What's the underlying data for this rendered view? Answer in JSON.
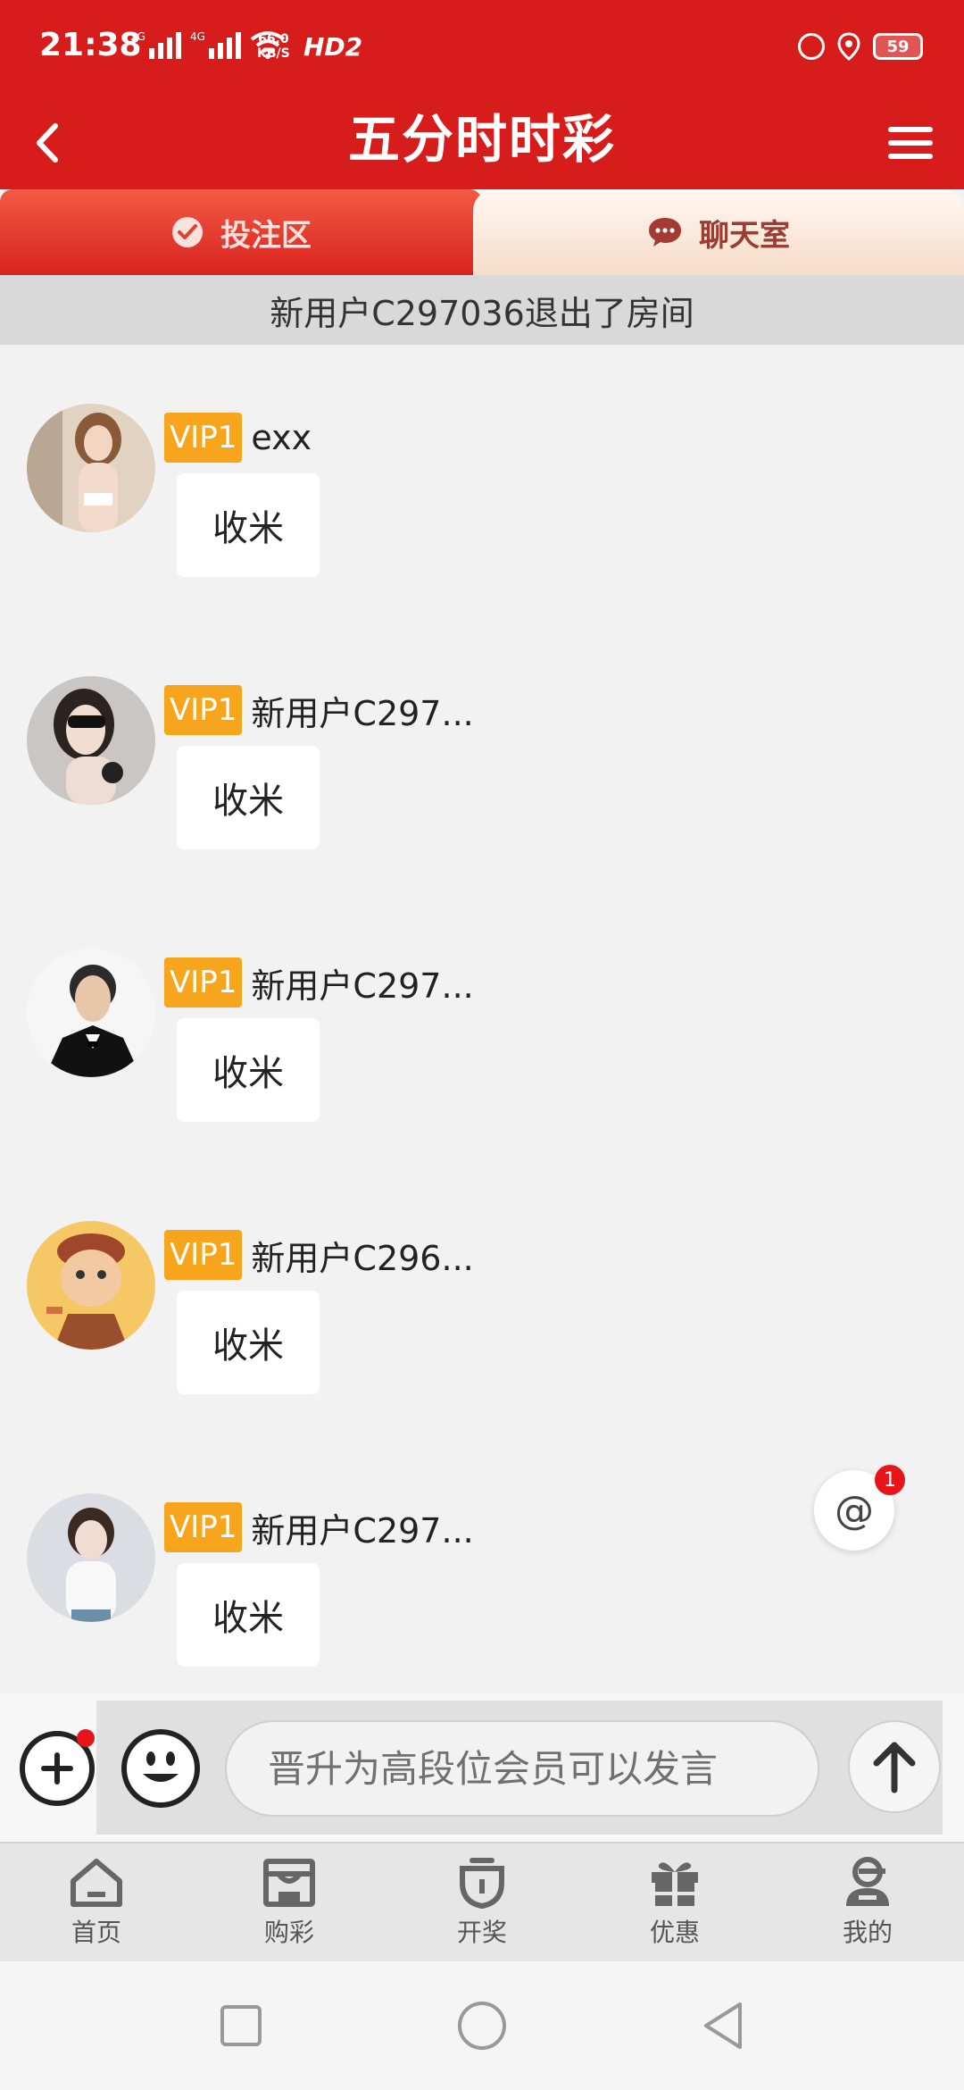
{
  "status_bar": {
    "time": "21:38",
    "signal_1_label": "2G",
    "signal_2_label": "4G",
    "speed_value": "66.0",
    "speed_unit": "KB/S",
    "hd_label": "HD2",
    "battery": "59"
  },
  "header": {
    "title": "五分时时彩"
  },
  "tabs": [
    {
      "label": "投注区",
      "icon": "check-circle-icon"
    },
    {
      "label": "聊天室",
      "icon": "chat-bubble-icon"
    }
  ],
  "notice": "新用户C297036退出了房间",
  "messages": [
    {
      "vip": "VIP1",
      "username": "exx",
      "text": "收米"
    },
    {
      "vip": "VIP1",
      "username": "新用户C297...",
      "text": "收米"
    },
    {
      "vip": "VIP1",
      "username": "新用户C297...",
      "text": "收米"
    },
    {
      "vip": "VIP1",
      "username": "新用户C296...",
      "text": "收米"
    },
    {
      "vip": "VIP1",
      "username": "新用户C297...",
      "text": "收米"
    }
  ],
  "mention_fab": {
    "symbol": "@",
    "badge": "1"
  },
  "input": {
    "placeholder": "晋升为高段位会员可以发言"
  },
  "bottom_nav": [
    {
      "label": "首页",
      "icon": "home-icon"
    },
    {
      "label": "购彩",
      "icon": "store-icon"
    },
    {
      "label": "开奖",
      "icon": "trophy-icon"
    },
    {
      "label": "优惠",
      "icon": "gift-icon"
    },
    {
      "label": "我的",
      "icon": "user-icon"
    }
  ],
  "colors": {
    "brand_red": "#d71d1c",
    "vip_orange": "#f7a51c",
    "badge_red": "#e8141a"
  }
}
